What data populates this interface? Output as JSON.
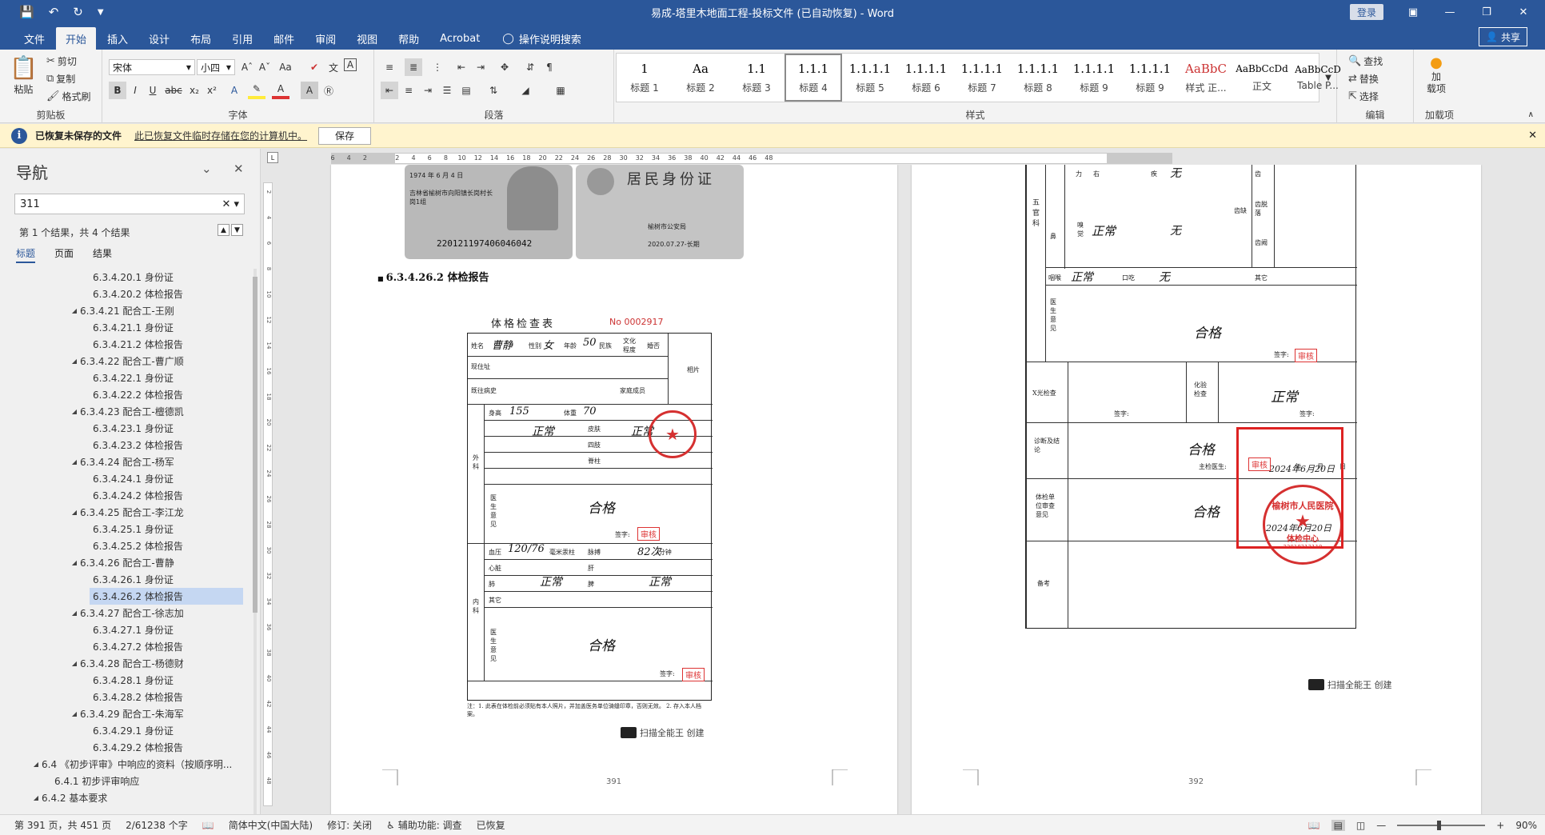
{
  "window": {
    "title": "易成-塔里木地面工程-投标文件 (已自动恢复)  -  Word",
    "login": "登录",
    "share": "共享",
    "qat": [
      "save-icon",
      "undo-icon",
      "redo-icon",
      "customize-icon"
    ]
  },
  "tabs": [
    "文件",
    "开始",
    "插入",
    "设计",
    "布局",
    "引用",
    "邮件",
    "审阅",
    "视图",
    "帮助",
    "Acrobat"
  ],
  "active_tab": "开始",
  "tellme": "操作说明搜索",
  "ribbon": {
    "clipboard": {
      "paste": "粘贴",
      "cut": "剪切",
      "copy": "复制",
      "format_painter": "格式刷",
      "label": "剪贴板"
    },
    "font": {
      "family": "宋体",
      "size": "小四",
      "label": "字体"
    },
    "paragraph": {
      "label": "段落"
    },
    "styles": {
      "label": "样式",
      "items": [
        {
          "sample": "1",
          "name": "标题 1"
        },
        {
          "sample": "Aa",
          "name": "标题 2"
        },
        {
          "sample": "1.1",
          "name": "标题 3"
        },
        {
          "sample": "1.1.1",
          "name": "标题 4"
        },
        {
          "sample": "1.1.1.1",
          "name": "标题 5"
        },
        {
          "sample": "1.1.1.1",
          "name": "标题 6"
        },
        {
          "sample": "1.1.1.1",
          "name": "标题 7"
        },
        {
          "sample": "1.1.1.1",
          "name": "标题 8"
        },
        {
          "sample": "1.1.1.1",
          "name": "标题 9"
        },
        {
          "sample": "1.1.1.1",
          "name": "标题 9"
        },
        {
          "sample": "AaBbC",
          "name": "样式 正..."
        },
        {
          "sample": "AaBbCcDd",
          "name": "正文"
        },
        {
          "sample": "AaBbCcD",
          "name": "Table P..."
        }
      ]
    },
    "editing": {
      "find": "查找",
      "replace": "替换",
      "select": "选择",
      "label": "编辑"
    },
    "addins": {
      "label": "加载项",
      "button": "加\n载项"
    }
  },
  "infobar": {
    "title": "已恢复未保存的文件",
    "message": "此已恢复文件临时存储在您的计算机中。",
    "save": "保存"
  },
  "nav": {
    "title": "导航",
    "search": "311",
    "result": "第 1 个结果，共 4 个结果",
    "tabs": [
      "标题",
      "页面",
      "结果"
    ],
    "items": [
      {
        "text": "6.3.4.20.1 身份证",
        "level": 3
      },
      {
        "text": "6.3.4.20.2 体检报告",
        "level": 3
      },
      {
        "text": "6.3.4.21 配合工-王刚",
        "level": 2
      },
      {
        "text": "6.3.4.21.1 身份证",
        "level": 3
      },
      {
        "text": "6.3.4.21.2 体检报告",
        "level": 3
      },
      {
        "text": "6.3.4.22 配合工-曹广顺",
        "level": 2
      },
      {
        "text": "6.3.4.22.1 身份证",
        "level": 3
      },
      {
        "text": "6.3.4.22.2 体检报告",
        "level": 3
      },
      {
        "text": "6.3.4.23 配合工-檀德凯",
        "level": 2
      },
      {
        "text": "6.3.4.23.1 身份证",
        "level": 3
      },
      {
        "text": "6.3.4.23.2 体检报告",
        "level": 3
      },
      {
        "text": "6.3.4.24 配合工-杨军",
        "level": 2
      },
      {
        "text": "6.3.4.24.1 身份证",
        "level": 3
      },
      {
        "text": "6.3.4.24.2 体检报告",
        "level": 3
      },
      {
        "text": "6.3.4.25 配合工-李江龙",
        "level": 2
      },
      {
        "text": "6.3.4.25.1 身份证",
        "level": 3
      },
      {
        "text": "6.3.4.25.2 体检报告",
        "level": 3
      },
      {
        "text": "6.3.4.26 配合工-曹静",
        "level": 2
      },
      {
        "text": "6.3.4.26.1 身份证",
        "level": 3
      },
      {
        "text": "6.3.4.26.2 体检报告",
        "level": 3,
        "selected": true
      },
      {
        "text": "6.3.4.27 配合工-徐志加",
        "level": 2
      },
      {
        "text": "6.3.4.27.1 身份证",
        "level": 3
      },
      {
        "text": "6.3.4.27.2 体检报告",
        "level": 3
      },
      {
        "text": "6.3.4.28 配合工-杨德财",
        "level": 2
      },
      {
        "text": "6.3.4.28.1 身份证",
        "level": 3
      },
      {
        "text": "6.3.4.28.2 体检报告",
        "level": 3
      },
      {
        "text": "6.3.4.29 配合工-朱海军",
        "level": 2
      },
      {
        "text": "6.3.4.29.1 身份证",
        "level": 3
      },
      {
        "text": "6.3.4.29.2 体检报告",
        "level": 3
      },
      {
        "text": "6.4 《初步评审》中响应的资料（按顺序明...",
        "level": 0
      },
      {
        "text": "6.4.1 初步评审响应",
        "level": 1
      },
      {
        "text": "6.4.2 基本要求",
        "level": 0
      }
    ]
  },
  "ruler": {
    "h": [
      "6",
      "4",
      "2",
      "",
      "2",
      "4",
      "6",
      "8",
      "10",
      "12",
      "14",
      "16",
      "18",
      "20",
      "22",
      "24",
      "26",
      "28",
      "30",
      "32",
      "34",
      "36",
      "38",
      "40",
      "42",
      "44",
      "46",
      "48"
    ],
    "v": [
      "2",
      "4",
      "6",
      "8",
      "10",
      "12",
      "14",
      "16",
      "18",
      "20",
      "22",
      "24",
      "26",
      "28",
      "30",
      "32",
      "34",
      "36",
      "38",
      "40",
      "42",
      "44",
      "46",
      "48"
    ]
  },
  "page_left": {
    "heading": "6.3.4.26.2 体检报告",
    "page_number": "391",
    "id_card": {
      "birth": "1974 年 6 月 4 日",
      "address": "吉林省榆树市向阳镇长岗村长岗1组",
      "id_number": "220121197406046042",
      "title": "居民身份证",
      "issuer": "榆树市公安局",
      "validity": "2020.07.27-长期"
    },
    "form": {
      "title": "体格检查表",
      "serial": "No 0002917",
      "labels": [
        "姓名",
        "性别",
        "年龄",
        "民族",
        "文化程度",
        "婚否",
        "现住址",
        "既往病史",
        "家庭成员",
        "身高",
        "体重",
        "皮肤",
        "四肢",
        "脊柱",
        "外科",
        "医生意见",
        "签字:",
        "血压",
        "毫米汞柱",
        "脉搏",
        "/分钟",
        "心脏",
        "肺",
        "肝",
        "脾",
        "内科",
        "其它",
        "医生意见",
        "签字:"
      ],
      "handwriting": {
        "name": "曹静",
        "sex": "女",
        "age": "50",
        "height": "155",
        "weight": "70",
        "surgery": "正常",
        "limbs": "正常",
        "verdict1": "合格",
        "bp": "120/76",
        "pulse": "82次",
        "heart": "正常",
        "lung": "正常",
        "verdict2": "合格"
      },
      "stamp": "审核",
      "note": "注：1. 此表在体检前必须贴有本人照片，并加盖医务单位骑缝印章，否则无效。 2. 存入本人档案。",
      "photo": "相片"
    },
    "scan": "扫描全能王 创建"
  },
  "page_right": {
    "page_number": "392",
    "form": {
      "labels": [
        "五官科",
        "力",
        "右",
        "嗅觉",
        "鼻",
        "咽喉",
        "口吃",
        "其它",
        "疾",
        "齿",
        "齿脱落",
        "齿缺",
        "齿阙",
        "医生意见",
        "签字:",
        "X光检查",
        "签字:",
        "化验检查",
        "签字:",
        "诊断及结论",
        "主检医生:",
        "体检单位审查意见",
        "备考",
        "年",
        "月",
        "日"
      ],
      "handwriting": {
        "eye": "无",
        "smell": "正常",
        "nose": "无",
        "throat": "正常",
        "stutter": "无",
        "verdict_ent": "合格",
        "lab": "正常",
        "diagnosis": "合格",
        "unit": "合格",
        "date1": "2024年6月20日",
        "date2": "2024年6月20日"
      },
      "seal_text": "榆树市人民医院",
      "seal_sub": "体检中心",
      "seal_code": "22018213110",
      "stamp": "审核"
    },
    "scan": "扫描全能王 创建"
  },
  "status": {
    "page": "第 391 页，共 451 页",
    "words": "2/61238 个字",
    "language": "简体中文(中国大陆)",
    "track": "修订: 关闭",
    "accessibility": "辅助功能: 调查",
    "recovered": "已恢复",
    "zoom": "90%"
  }
}
